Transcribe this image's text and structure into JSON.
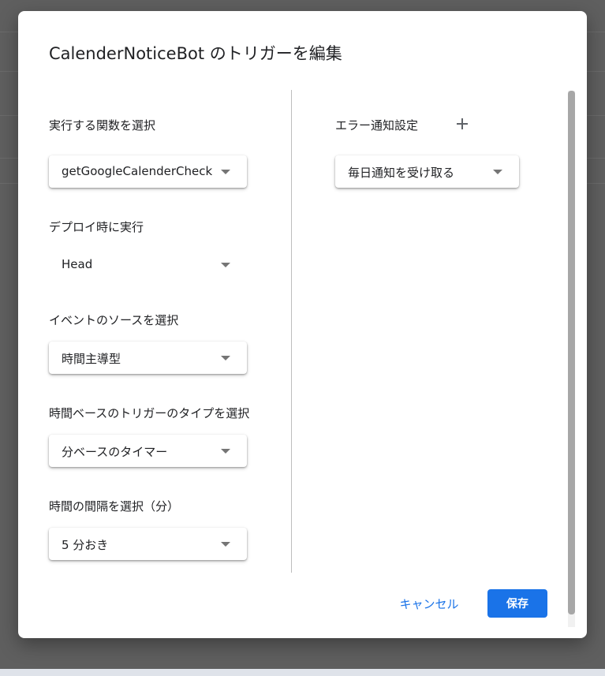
{
  "dialog": {
    "title": "CalenderNoticeBot のトリガーを編集"
  },
  "left_panel": {
    "function_field": {
      "label": "実行する関数を選択",
      "value": "getGoogleCalenderCheck"
    },
    "deployment_field": {
      "label": "デプロイ時に実行",
      "value": "Head"
    },
    "event_source_field": {
      "label": "イベントのソースを選択",
      "value": "時間主導型"
    },
    "trigger_type_field": {
      "label": "時間ベースのトリガーのタイプを選択",
      "value": "分ベースのタイマー"
    },
    "interval_field": {
      "label": "時間の間隔を選択（分）",
      "value": "5 分おき"
    }
  },
  "right_panel": {
    "error_notification": {
      "label": "エラー通知設定",
      "add_icon": "plus-icon",
      "value": "毎日通知を受け取る"
    }
  },
  "actions": {
    "cancel_label": "キャンセル",
    "save_label": "保存"
  },
  "colors": {
    "primary": "#1a73e8",
    "backdrop": "#5f5f5f",
    "text": "#202124"
  }
}
